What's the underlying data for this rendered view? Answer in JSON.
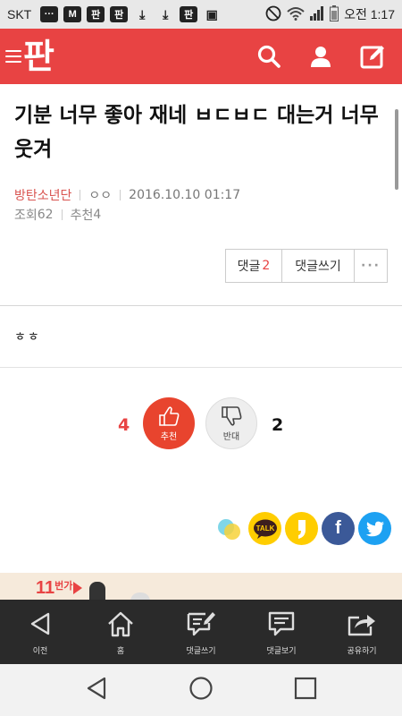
{
  "status_bar": {
    "carrier": "SKT",
    "time": "오전 1:17",
    "icons": [
      "message-icon",
      "m-icon",
      "pan-icon",
      "pan-icon",
      "download-icon",
      "download-icon",
      "pan-icon",
      "image-icon",
      "no-disturb-icon",
      "wifi-icon",
      "signal-icon",
      "battery-icon"
    ]
  },
  "app_bar": {
    "logo": "판",
    "accent": "#e84343"
  },
  "post": {
    "title": "기분 너무 좋아 재네 ㅂㄷㅂㄷ 대는거 너무 웃겨",
    "author": "방탄소년단",
    "author_sub": "ㅇㅇ",
    "date": "2016.10.10 01:17",
    "views_label": "조회",
    "views": "62",
    "recommend_label": "추천",
    "recommend": "4",
    "body": "ㅎㅎ"
  },
  "post_actions": {
    "comment_label": "댓글",
    "comment_count": "2",
    "write_comment": "댓글쓰기",
    "more": "···"
  },
  "vote": {
    "up_count": "4",
    "up_label": "추천",
    "down_label": "반대",
    "down_count": "2"
  },
  "share": {
    "kakao_label": "TALK",
    "facebook_label": "f"
  },
  "ad": {
    "brand_main": "11",
    "brand_sub": "번가"
  },
  "toolbar": {
    "items": [
      {
        "label": "이전",
        "icon": "back-icon"
      },
      {
        "label": "홈",
        "icon": "home-icon"
      },
      {
        "label": "댓글쓰기",
        "icon": "write-comment-icon"
      },
      {
        "label": "댓글보기",
        "icon": "view-comment-icon"
      },
      {
        "label": "공유하기",
        "icon": "share-icon"
      }
    ]
  }
}
